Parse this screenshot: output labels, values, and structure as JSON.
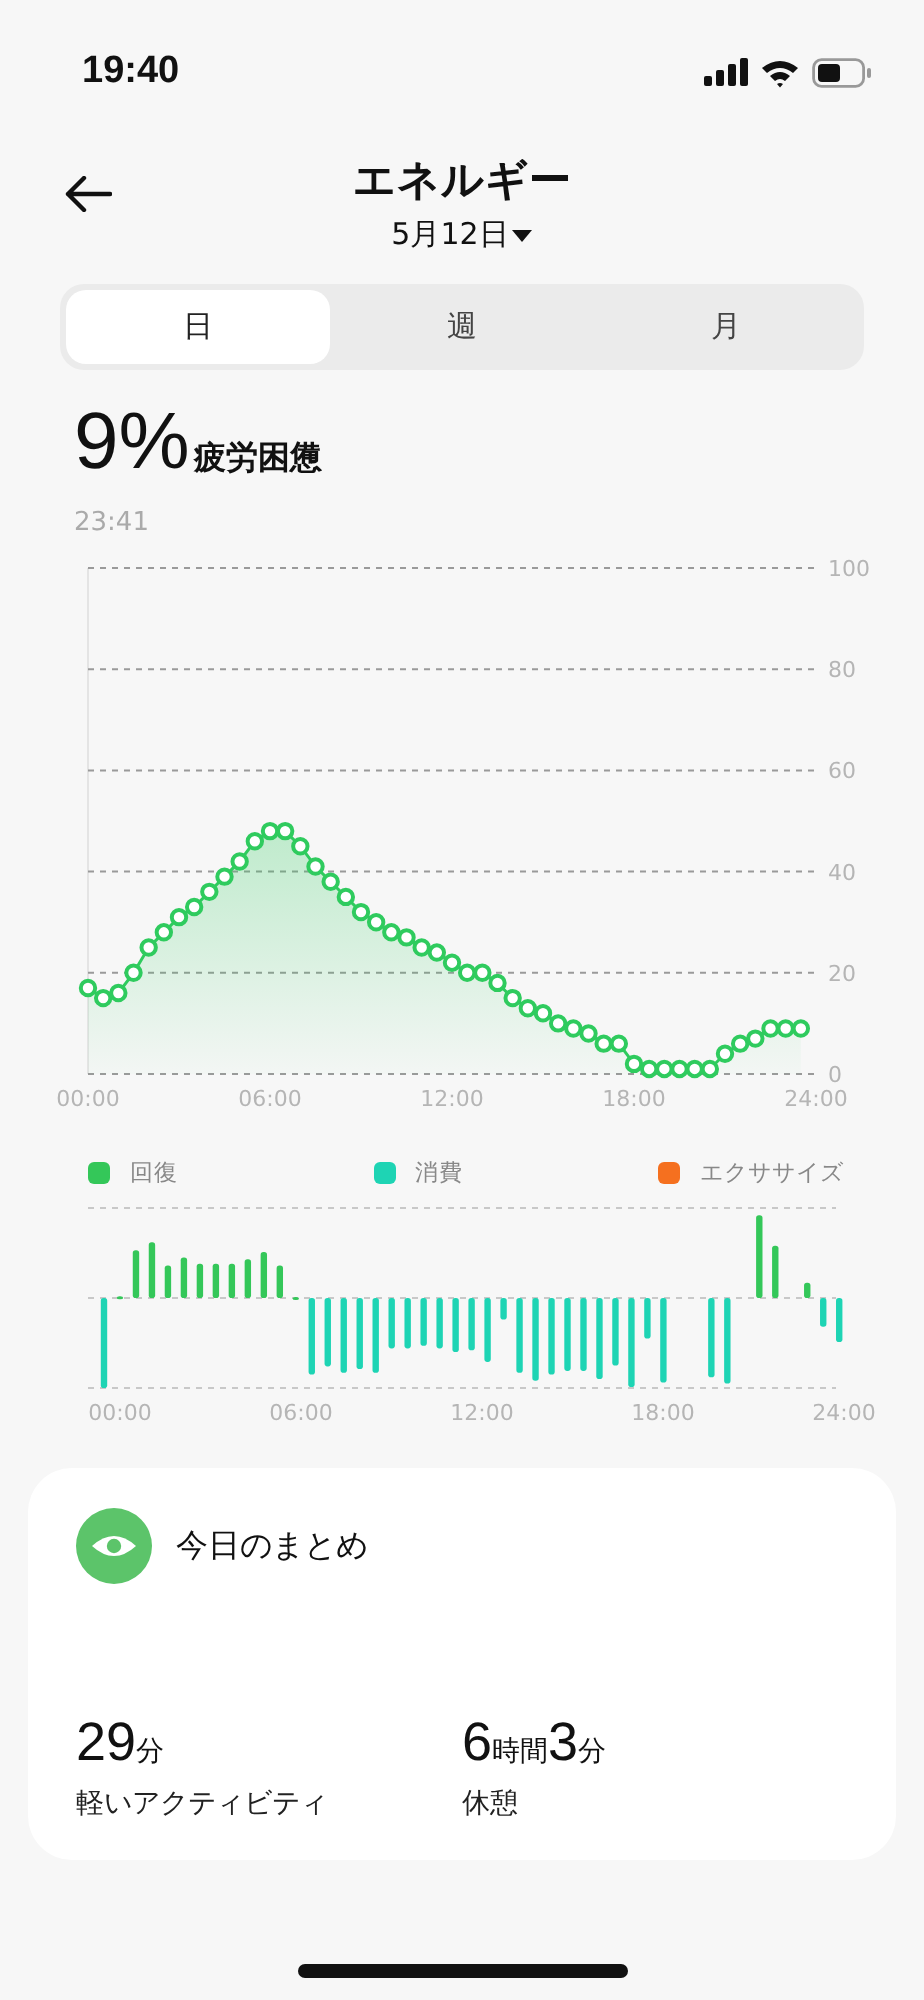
{
  "status_bar": {
    "time": "19:40"
  },
  "header": {
    "title": "エネルギー",
    "date": "5月12日"
  },
  "tabs": [
    {
      "label": "日",
      "selected": true
    },
    {
      "label": "週",
      "selected": false
    },
    {
      "label": "月",
      "selected": false
    }
  ],
  "energy": {
    "value": "9%",
    "label": "疲労困憊",
    "time": "23:41",
    "chart_data": {
      "type": "area",
      "x": [
        0,
        0.5,
        1,
        1.5,
        2,
        2.5,
        3,
        3.5,
        4,
        4.5,
        5,
        5.5,
        6,
        6.5,
        7,
        7.5,
        8,
        8.5,
        9,
        9.5,
        10,
        10.5,
        11,
        11.5,
        12,
        12.5,
        13,
        13.5,
        14,
        14.5,
        15,
        15.5,
        16,
        16.5,
        17,
        17.5,
        18,
        18.5,
        19,
        19.5,
        20,
        20.5,
        21,
        21.5,
        22,
        22.5,
        23,
        23.5
      ],
      "series": [
        {
          "color": "#2fcb5e",
          "values": [
            17,
            15,
            16,
            20,
            25,
            28,
            31,
            33,
            36,
            39,
            42,
            46,
            48,
            48,
            45,
            41,
            38,
            35,
            32,
            30,
            28,
            27,
            25,
            24,
            22,
            20,
            20,
            18,
            15,
            13,
            12,
            10,
            9,
            8,
            6,
            6,
            2,
            1,
            1,
            1,
            1,
            1,
            4,
            6,
            7,
            9,
            9,
            9
          ]
        }
      ],
      "xlim": [
        0,
        24
      ],
      "ylim": [
        0,
        100
      ],
      "xticks": [
        {
          "value": 0,
          "label": "00:00"
        },
        {
          "value": 6,
          "label": "06:00"
        },
        {
          "value": 12,
          "label": "12:00"
        },
        {
          "value": 18,
          "label": "18:00"
        },
        {
          "value": 24,
          "label": "24:00"
        }
      ],
      "yticks": [
        0,
        20,
        40,
        60,
        80,
        100
      ],
      "grid": true
    }
  },
  "balance": {
    "legend": [
      {
        "label": "回復",
        "color": "#34c759"
      },
      {
        "label": "消費",
        "color": "#1ed4b4"
      },
      {
        "label": "エクササイズ",
        "color": "#f5701f"
      }
    ],
    "x_labels": [
      "00:00",
      "06:00",
      "12:00",
      "18:00",
      "24:00"
    ]
  },
  "summary": {
    "title": "今日のまとめ",
    "stats": [
      {
        "parts": [
          {
            "text": "29",
            "kind": "number"
          },
          {
            "text": "分",
            "kind": "unit"
          }
        ],
        "label": "軽いアクティビティ"
      },
      {
        "parts": [
          {
            "text": "6",
            "kind": "number"
          },
          {
            "text": "時間",
            "kind": "unit"
          },
          {
            "text": "3",
            "kind": "number"
          },
          {
            "text": "分",
            "kind": "unit"
          }
        ],
        "label": "休憩"
      }
    ]
  }
}
